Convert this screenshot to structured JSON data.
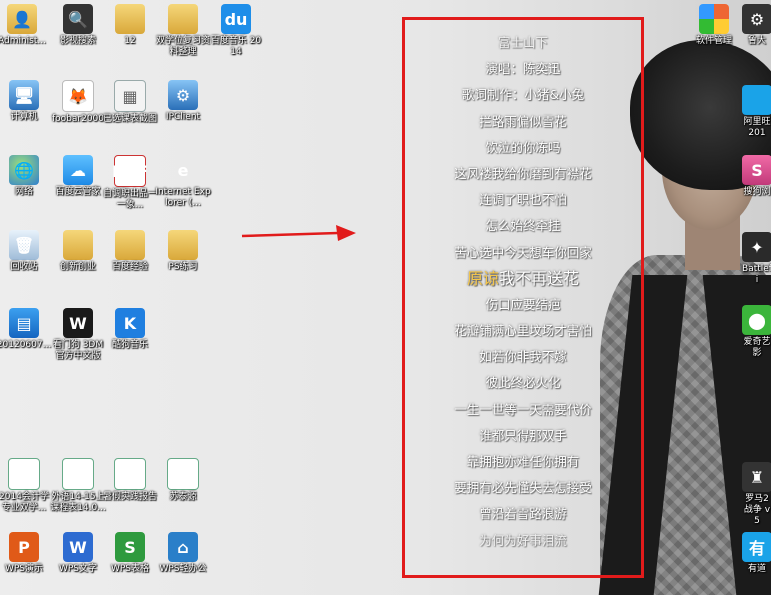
{
  "desktop": {
    "icons": [
      {
        "label": "Administ...",
        "glyph": "👤"
      },
      {
        "label": "影视搜索",
        "glyph": "🔍"
      },
      {
        "label": "12",
        "glyph": ""
      },
      {
        "label": "双学位复习资料整理",
        "glyph": ""
      },
      {
        "label": "百度音乐 2014",
        "glyph": "du"
      },
      {
        "label": "计算机",
        "glyph": "🖥"
      },
      {
        "label": "foobar2000",
        "glyph": "🦊"
      },
      {
        "label": "已选课表截图",
        "glyph": "▦"
      },
      {
        "label": "IPClient",
        "glyph": "⚙"
      },
      {
        "label": "网络",
        "glyph": "🌐"
      },
      {
        "label": "百度云管家",
        "glyph": "☁"
      },
      {
        "label": "自调职出品一一象...",
        "glyph": "PDF"
      },
      {
        "label": "Internet Explorer (...",
        "glyph": "e"
      },
      {
        "label": "回收站",
        "glyph": "🗑"
      },
      {
        "label": "创新创业",
        "glyph": ""
      },
      {
        "label": "百度经验",
        "glyph": ""
      },
      {
        "label": "PS练习",
        "glyph": ""
      },
      {
        "label": "20120607...",
        "glyph": "▤"
      },
      {
        "label": "看门狗 3DM官方中文版",
        "glyph": "W"
      },
      {
        "label": "酷狗音乐",
        "glyph": "K"
      },
      {
        "label": "2014会计学专业双学...",
        "glyph": "≡"
      },
      {
        "label": "外语14-15上课程表14.0...",
        "glyph": "≡"
      },
      {
        "label": "暑假实践报告",
        "glyph": "≡"
      },
      {
        "label": "苏泰源",
        "glyph": "≡"
      },
      {
        "label": "WPS演示",
        "glyph": "P"
      },
      {
        "label": "WPS文字",
        "glyph": "W"
      },
      {
        "label": "WPS表格",
        "glyph": "S"
      },
      {
        "label": "WPS轻办公",
        "glyph": "⌂"
      },
      {
        "label": "软件管理",
        "glyph": ""
      },
      {
        "label": "鲁大",
        "glyph": "⚙"
      },
      {
        "label": "阿里旺 201",
        "glyph": ""
      },
      {
        "label": "搜狗浏",
        "glyph": "S"
      },
      {
        "label": "Battlefi",
        "glyph": "✦"
      },
      {
        "label": "爱奇艺 影",
        "glyph": "⬤"
      },
      {
        "label": "罗马2 战争 v5",
        "glyph": "♜"
      },
      {
        "label": "有道",
        "glyph": "有"
      }
    ]
  },
  "lyrics": {
    "lines": [
      "富士山下",
      "演唱：陈奕迅",
      "歌词制作：小猪&小兔",
      "拦路雨偏似雪花",
      "饮泣的你冻吗",
      "这风褛我给你磨到有襟花",
      "连调了职也不怕",
      "怎么始终牵挂",
      "苦心选中今天想车你回家",
      "伤口应要结疤",
      "花瓣铺满心里坟场才害怕",
      "如若你非我不嫁",
      "彼此终必火化",
      "一生一世等一天需要代价",
      "谁都只得那双手",
      "靠拥抱亦难任你拥有",
      "要拥有必先懂失去怎接受",
      "曾沿着雪路浪游",
      "为何为好事泪流"
    ],
    "current_line": {
      "sung": "原谅",
      "unsung": "我不再送花"
    }
  }
}
